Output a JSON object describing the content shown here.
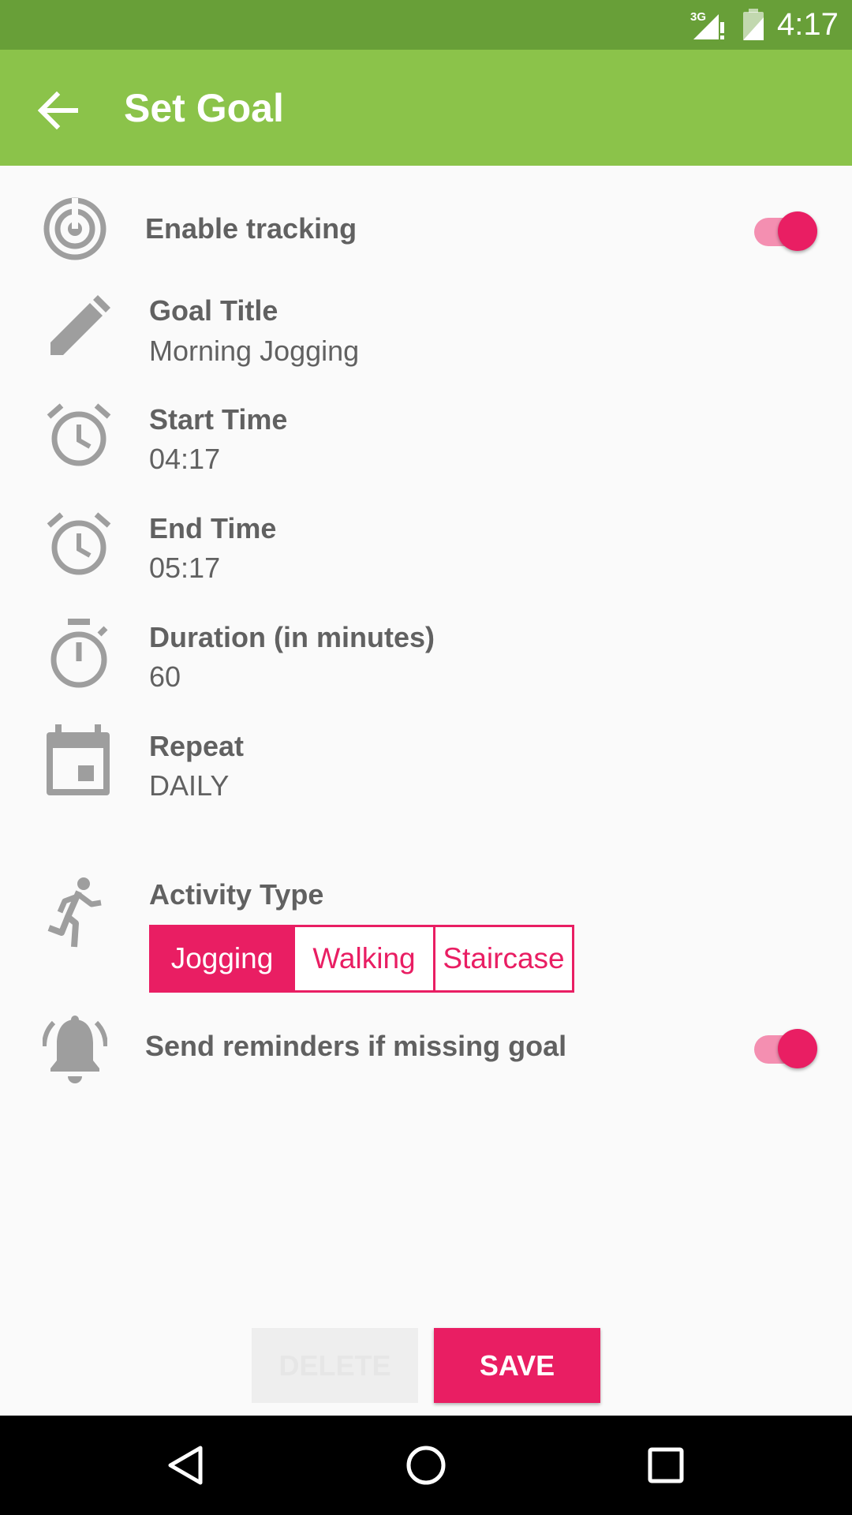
{
  "status_bar": {
    "time": "4:17",
    "network": "3G"
  },
  "app_bar": {
    "title": "Set Goal"
  },
  "rows": {
    "tracking": {
      "label": "Enable tracking",
      "enabled": true
    },
    "goal_title": {
      "label": "Goal Title",
      "value": "Morning Jogging"
    },
    "start_time": {
      "label": "Start Time",
      "value": "04:17"
    },
    "end_time": {
      "label": "End Time",
      "value": "05:17"
    },
    "duration": {
      "label": "Duration (in minutes)",
      "value": "60"
    },
    "repeat": {
      "label": "Repeat",
      "value": "DAILY"
    },
    "activity": {
      "label": "Activity Type",
      "options": [
        "Jogging",
        "Walking",
        "Staircase"
      ],
      "selected": "Jogging"
    },
    "reminders": {
      "label": "Send reminders if missing goal",
      "enabled": true
    }
  },
  "buttons": {
    "delete": "DELETE",
    "save": "SAVE"
  },
  "colors": {
    "primary": "#8BC34A",
    "primary_dark": "#689F38",
    "accent": "#E91E63",
    "icon_gray": "#9E9E9E",
    "text_gray": "#616161"
  },
  "icons": {
    "tracking": "target-icon",
    "goal_title": "pencil-icon",
    "start_time": "alarm-clock-icon",
    "end_time": "alarm-clock-icon",
    "duration": "stopwatch-icon",
    "repeat": "calendar-icon",
    "activity": "running-person-icon",
    "reminders": "bell-icon"
  }
}
